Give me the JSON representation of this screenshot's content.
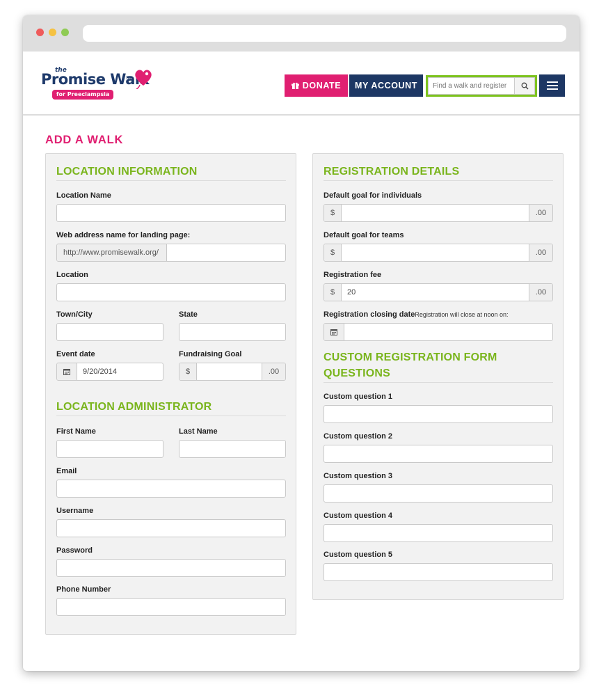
{
  "header": {
    "logo_the": "the",
    "logo_brand": "Promise Walk",
    "logo_tm": "TM",
    "logo_tagline": "for Preeclampsia",
    "donate_label": "DONATE",
    "account_label": "MY ACCOUNT",
    "search_placeholder": "Find a walk and register"
  },
  "colors": {
    "pink": "#e01f71",
    "navy": "#1d3764",
    "green": "#7ab51d",
    "search_highlight": "#7dc31f"
  },
  "page": {
    "title": "ADD A WALK"
  },
  "location_info": {
    "title": "LOCATION INFORMATION",
    "location_name_label": "Location Name",
    "web_address_label": "Web address name for landing page:",
    "web_address_prefix": "http://www.promisewalk.org/",
    "location_label": "Location",
    "town_label": "Town/City",
    "state_label": "State",
    "event_date_label": "Event date",
    "event_date_value": "9/20/2014",
    "fundraising_label": "Fundraising Goal",
    "currency_symbol": "$",
    "cents_suffix": ".00"
  },
  "location_admin": {
    "title": "LOCATION ADMINISTRATOR",
    "first_name_label": "First Name",
    "last_name_label": "Last Name",
    "email_label": "Email",
    "username_label": "Username",
    "password_label": "Password",
    "phone_label": "Phone Number"
  },
  "registration": {
    "title": "REGISTRATION DETAILS",
    "goal_individuals_label": "Default goal for individuals",
    "goal_teams_label": "Default goal for teams",
    "fee_label": "Registration fee",
    "fee_value": "20",
    "closing_label": "Registration closing date",
    "closing_note": "Registration will close at noon on:",
    "currency_symbol": "$",
    "cents_suffix": ".00"
  },
  "custom_questions": {
    "title_line1": "CUSTOM REGISTRATION FORM",
    "title_line2": "QUESTIONS",
    "q1": "Custom question 1",
    "q2": "Custom question 2",
    "q3": "Custom question 3",
    "q4": "Custom question 4",
    "q5": "Custom question 5"
  }
}
